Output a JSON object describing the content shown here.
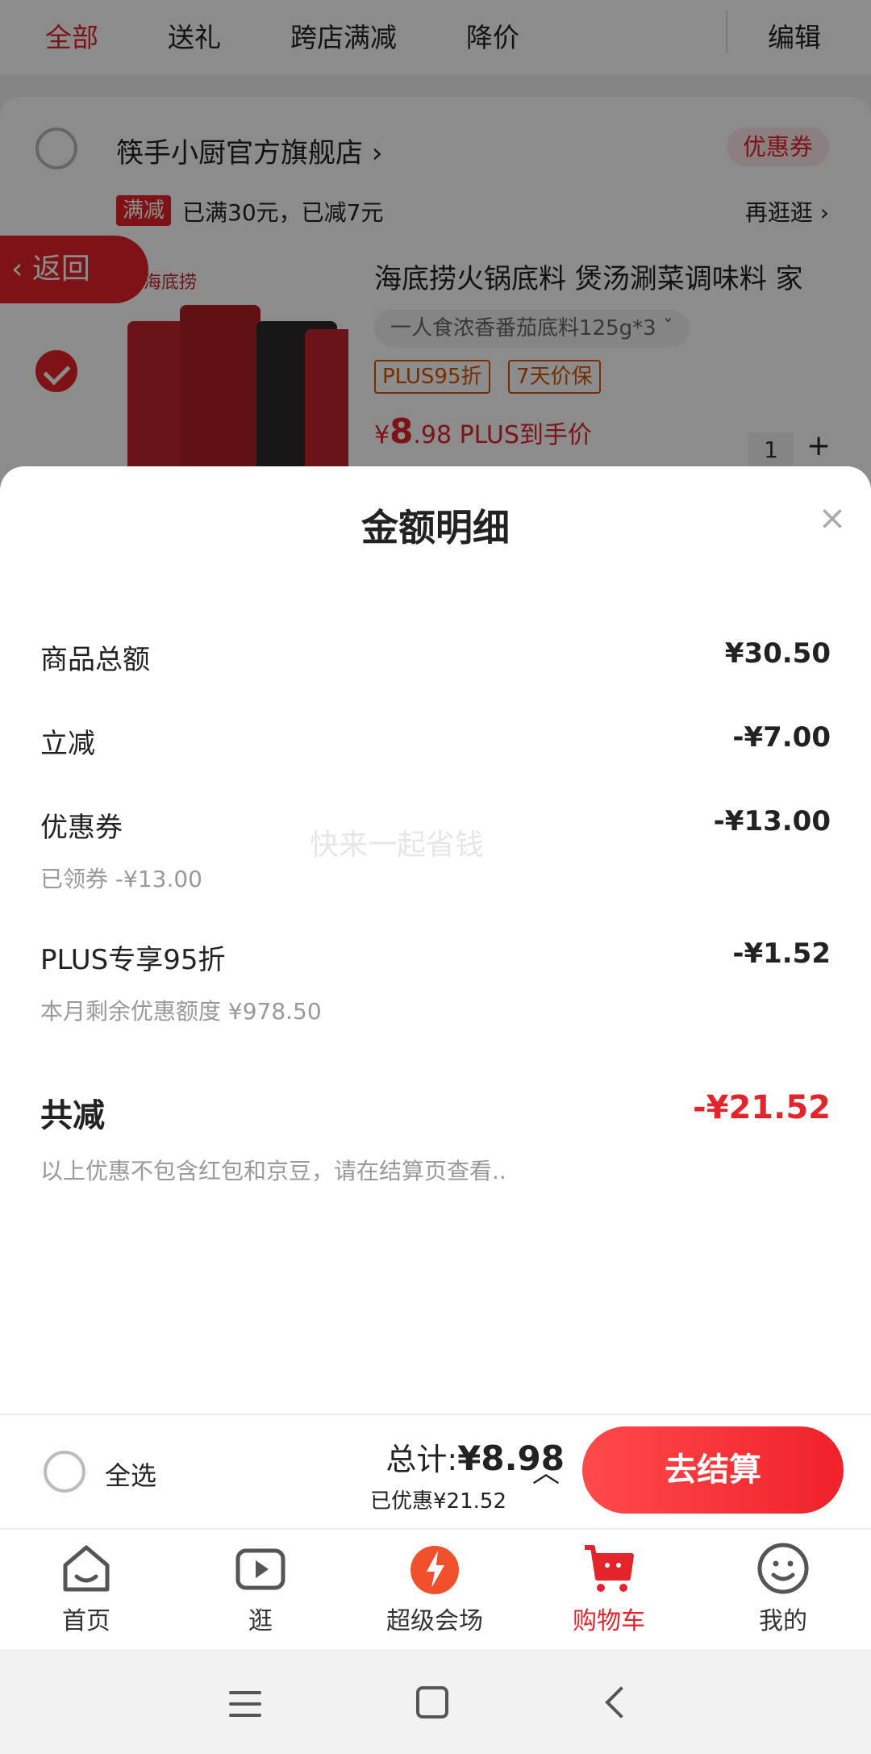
{
  "top_tabs": [
    "全部",
    "送礼",
    "跨店满减",
    "降价"
  ],
  "edit_label": "编辑",
  "shop": {
    "name": "筷手小厨官方旗舰店",
    "chevron": "›",
    "coupon_tag": "优惠券",
    "promo_badge": "满减",
    "promo_text": "已满30元，已减7元",
    "browse": "再逛逛 ›"
  },
  "back_label": "返回",
  "product": {
    "brand_text": "海底捞",
    "title": "海底捞火锅底料 煲汤涮菜调味料 家",
    "spec": "一人食浓香番茄底料125g*3",
    "tags": [
      "PLUS95折",
      "7天价保"
    ],
    "price_symbol": "¥",
    "price_int": "8",
    "price_dec": ".98",
    "price_suffix": "PLUS到手价",
    "qty": "1",
    "plus": "+"
  },
  "sheet": {
    "title": "金额明细",
    "close": "×",
    "rows": [
      {
        "label": "商品总额",
        "value": "¥30.50",
        "sub": ""
      },
      {
        "label": "立减",
        "value": "-¥7.00",
        "sub": ""
      },
      {
        "label": "优惠券",
        "value": "-¥13.00",
        "sub": "已领券 -¥13.00"
      },
      {
        "label": "PLUS专享95折",
        "value": "-¥1.52",
        "sub": "本月剩余优惠额度 ¥978.50"
      }
    ],
    "total_label": "共减",
    "total_value": "-¥21.52",
    "note": "以上优惠不包含红包和京豆，请在结算页查看..",
    "watermark": "快来一起省钱"
  },
  "checkout": {
    "select_all": "全选",
    "sum_label": "总计:",
    "sum_value": "¥8.98",
    "saved": "已优惠¥21.52",
    "expand_icon": "︿",
    "button": "去结算"
  },
  "tabbar": [
    {
      "label": "首页",
      "icon": "home-icon"
    },
    {
      "label": "逛",
      "icon": "video-icon"
    },
    {
      "label": "超级会场",
      "icon": "super-venue-icon"
    },
    {
      "label": "购物车",
      "icon": "cart-icon",
      "active": true
    },
    {
      "label": "我的",
      "icon": "profile-icon"
    }
  ],
  "colors": {
    "accent": "#e3242b",
    "tag_orange": "#d35400"
  }
}
